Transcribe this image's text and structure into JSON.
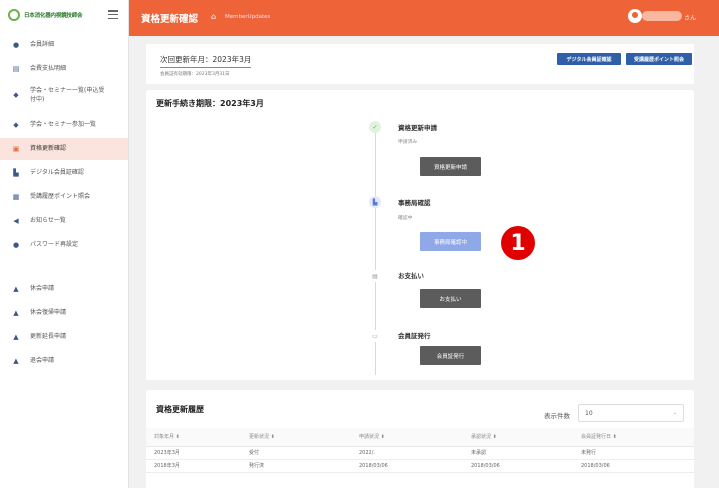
{
  "sidebar": {
    "logo_text": "日本消化器内視鏡技師会",
    "items": [
      {
        "icon": "info-icon",
        "glyph": "●",
        "label": "会員詳細"
      },
      {
        "icon": "receipt-icon",
        "glyph": "▤",
        "label": "会費支払明細"
      },
      {
        "icon": "graduation-icon",
        "glyph": "◆",
        "label": "学会・セミナー一覧(申込受付中)"
      },
      {
        "icon": "graduation-icon",
        "glyph": "◆",
        "label": "学会・セミナー参加一覧"
      },
      {
        "icon": "id-card-icon",
        "glyph": "▣",
        "label": "資格更新確認",
        "active": true
      },
      {
        "icon": "building-icon",
        "glyph": "▙",
        "label": "デジタル会員証確認"
      },
      {
        "icon": "list-icon",
        "glyph": "▦",
        "label": "受講履歴ポイント照会"
      },
      {
        "icon": "megaphone-icon",
        "glyph": "◀",
        "label": "お知らせ一覧"
      },
      {
        "icon": "key-icon",
        "glyph": "●",
        "label": "パスワード再設定"
      },
      {
        "icon": "person-icon",
        "glyph": "▲",
        "label": "休会申請"
      },
      {
        "icon": "person-icon",
        "glyph": "▲",
        "label": "休会復帰申請"
      },
      {
        "icon": "person-icon",
        "glyph": "▲",
        "label": "更新延長申請"
      },
      {
        "icon": "person-icon",
        "glyph": "▲",
        "label": "退会申請"
      }
    ]
  },
  "header": {
    "title": "資格更新確認",
    "breadcrumb": "MemberUpdates",
    "user_suffix": "さん"
  },
  "top_card": {
    "renewal_month": "次回更新年月：2023年3月",
    "expiry": "会員証有効期限：2023年3月31日",
    "btn_digital": "デジタル会員証確認",
    "btn_points": "受講履歴ポイント照会"
  },
  "steps": {
    "deadline": "更新手続き期限：2023年3月",
    "items": [
      {
        "title": "資格更新申請",
        "sub": "申請済み",
        "button": "資格更新申請",
        "icon": "check-icon",
        "icon_color": "#4caf50",
        "icon_bg": "#dff3df"
      },
      {
        "title": "事務局確認",
        "sub": "確認中",
        "button": "事務局確認中",
        "icon": "building-icon",
        "icon_color": "#5a7bd6",
        "icon_bg": "#e3e9fa"
      },
      {
        "title": "お支払い",
        "sub": "",
        "button": "お支払い",
        "icon": "wallet-icon",
        "icon_color": "#999999",
        "icon_bg": "#ffffff"
      },
      {
        "title": "会員証発行",
        "sub": "",
        "button": "会員証発行",
        "icon": "card-icon",
        "icon_color": "#999999",
        "icon_bg": "#ffffff"
      }
    ],
    "marker": "1"
  },
  "history": {
    "title": "資格更新履歴",
    "count_label": "表示件数",
    "count_value": "10",
    "columns": [
      "対象年月 ⬍",
      "更新状況 ⬍",
      "申請状況 ⬍",
      "承認状況 ⬍",
      "会員証発行日 ⬍"
    ],
    "rows": [
      [
        "2023年3月",
        "受付",
        "2022/.",
        "未承認",
        "未発行"
      ],
      [
        "2018年3月",
        "発行済",
        "2018/03/06",
        "2018/03/06",
        "2018/03/06"
      ]
    ]
  },
  "colors": {
    "accent": "#ee6338",
    "primary_button": "#2f5fa8",
    "marker": "#e00000"
  }
}
